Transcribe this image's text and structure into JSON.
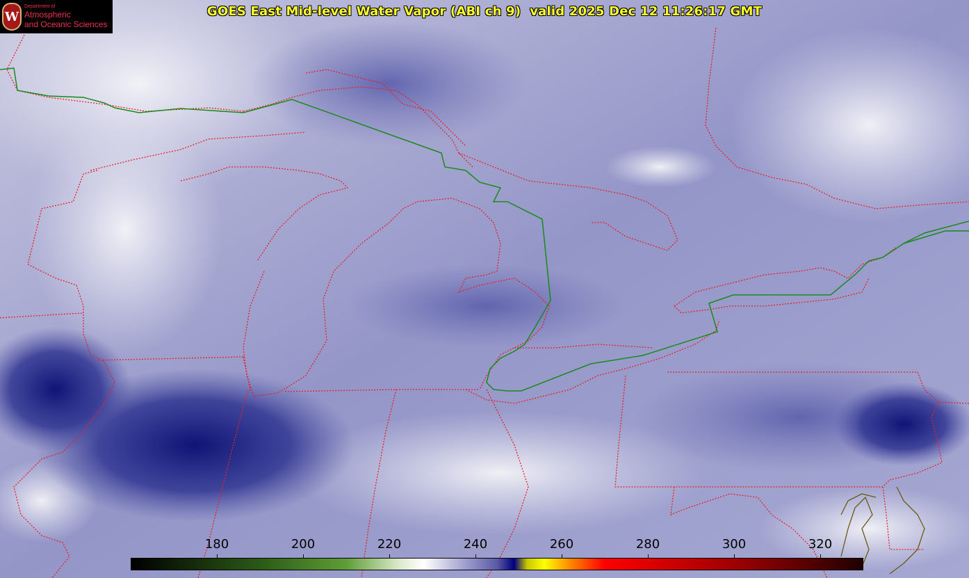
{
  "title": "GOES East Mid-level Water Vapor (ABI ch 9)  valid 2025 Dec 12 11:26:17 GMT",
  "logo": {
    "department": "Department of",
    "line1": "Atmospheric",
    "line2": "and Oceanic Sciences",
    "seal_letter": "W"
  },
  "colorbar": {
    "units_min": 160,
    "units_max": 330,
    "ticks": [
      "180",
      "200",
      "220",
      "240",
      "260",
      "280",
      "300",
      "320"
    ],
    "tick_values": [
      180,
      200,
      220,
      240,
      260,
      280,
      300,
      320
    ],
    "stops": [
      {
        "v": 160,
        "c": "#000000"
      },
      {
        "v": 190,
        "c": "#2a5a16"
      },
      {
        "v": 210,
        "c": "#5f9e37"
      },
      {
        "v": 222,
        "c": "#d8e8c8"
      },
      {
        "v": 228,
        "c": "#ffffff"
      },
      {
        "v": 238,
        "c": "#9a9ccb"
      },
      {
        "v": 245,
        "c": "#5a5aa6"
      },
      {
        "v": 249,
        "c": "#000080"
      },
      {
        "v": 252,
        "c": "#c8c800"
      },
      {
        "v": 256,
        "c": "#ffff00"
      },
      {
        "v": 262,
        "c": "#ff8800"
      },
      {
        "v": 270,
        "c": "#ff0000"
      },
      {
        "v": 300,
        "c": "#a00000"
      },
      {
        "v": 330,
        "c": "#200000"
      }
    ]
  },
  "colors": {
    "state_borders": "#e8202a",
    "international_border": "#1a8a1a",
    "coast_detail": "#6a5a10"
  }
}
